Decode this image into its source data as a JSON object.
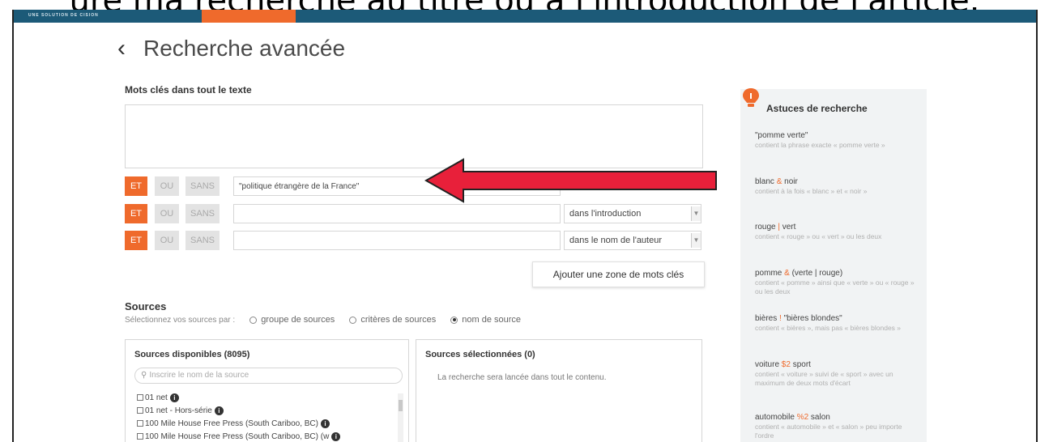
{
  "caption": "ure ma recherche au titre ou à l'introduction de l'article.",
  "topbar": {
    "brand": "UNE SOLUTION DE CISION"
  },
  "header": {
    "back_icon": "chevron-left-icon",
    "title": "Recherche avancée"
  },
  "keywords": {
    "label": "Mots clés dans tout le texte",
    "textarea_value": "",
    "rows": [
      {
        "et": "ET",
        "ou": "OU",
        "sans": "SANS",
        "value": "\"politique étrangère de la France\"",
        "scope": ""
      },
      {
        "et": "ET",
        "ou": "OU",
        "sans": "SANS",
        "value": "",
        "scope": "dans l'introduction"
      },
      {
        "et": "ET",
        "ou": "OU",
        "sans": "SANS",
        "value": "",
        "scope": "dans le nom de l'auteur"
      }
    ],
    "add_zone": "Ajouter une zone de mots clés"
  },
  "sources": {
    "title": "Sources",
    "select_prompt": "Sélectionnez vos sources par :",
    "options": [
      "groupe de sources",
      "critères de sources",
      "nom de source"
    ],
    "selected_option": "nom de source",
    "available_title": "Sources disponibles (8095)",
    "search_placeholder": "Inscrire le nom de la source",
    "available": [
      "01 net",
      "01 net - Hors-série",
      "100 Mile House Free Press (South Cariboo, BC)",
      "100 Mile House Free Press (South Cariboo, BC) (w"
    ],
    "selected_title": "Sources sélectionnées (0)",
    "selected_note": "La recherche sera lancée dans tout le contenu."
  },
  "tips": {
    "title": "Astuces de recherche",
    "items": [
      {
        "q": "\"pomme verte\"",
        "d": "contient la phrase exacte « pomme verte »"
      },
      {
        "q_pre": "blanc ",
        "op": "&",
        "q_post": " noir",
        "d": "contient à la fois « blanc » et « noir »"
      },
      {
        "q_pre": "rouge ",
        "op": "|",
        "q_post": " vert",
        "d": "contient « rouge » ou « vert » ou les deux"
      },
      {
        "q_pre": "pomme ",
        "op": "&",
        "q_post": " (verte | rouge)",
        "d": "contient « pomme » ainsi que « verte » ou « rouge » ou les deux"
      },
      {
        "q_pre": "bières ",
        "op": "!",
        "q_post": " \"bières blondes\"",
        "d": "contient « bières », mais pas « bières blondes »"
      },
      {
        "q_pre": "voiture ",
        "op": "$2",
        "q_post": " sport",
        "d": "contient « voiture » suivi de « sport » avec un maximum de deux mots d'écart"
      },
      {
        "q_pre": "automobile ",
        "op": "%2",
        "q_post": " salon",
        "d": "contient « automobile » et « salon » peu importe l'ordre"
      }
    ]
  },
  "colors": {
    "brand_orange": "#ef6a2c",
    "topbar": "#1c5a78",
    "arrow_red": "#e8203a"
  }
}
